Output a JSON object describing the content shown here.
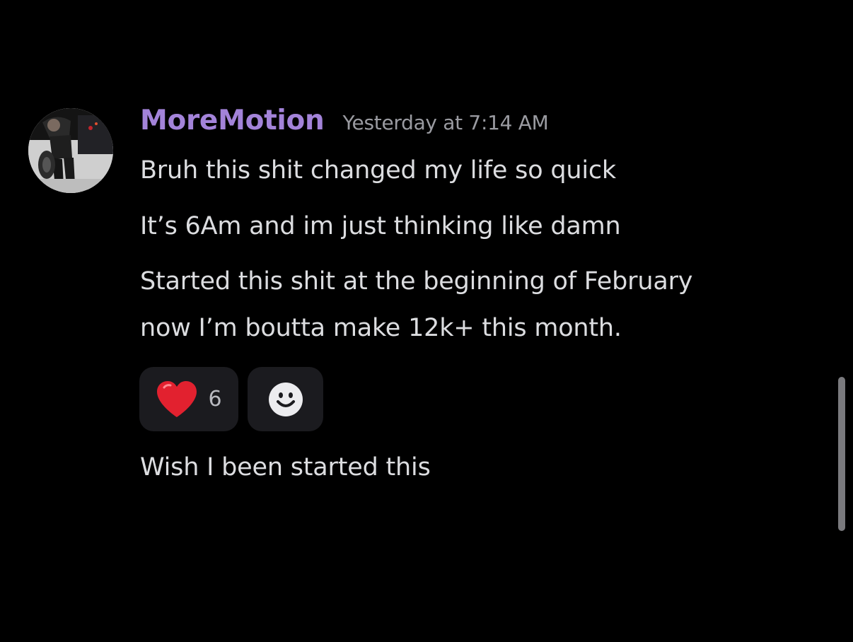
{
  "message": {
    "author": "MoreMotion",
    "timestamp": "Yesterday at 7:14 AM",
    "lines": [
      "Bruh this shit changed my life so quick",
      "It’s 6Am and im just thinking like damn",
      "Started this shit at the beginning of February\nnow I’m boutta make 12k+ this month.",
      "Wish I been started this"
    ],
    "reactions": [
      {
        "icon": "red-heart-emoji",
        "count": "6"
      }
    ],
    "add_reaction_icon": "smiley-face-icon"
  },
  "colors": {
    "background": "#000000",
    "username": "#a383d9",
    "timestamp": "#9a9ba1",
    "text": "#dcdde0",
    "reaction_bg": "#1b1b1f",
    "heart": "#e2212f"
  }
}
